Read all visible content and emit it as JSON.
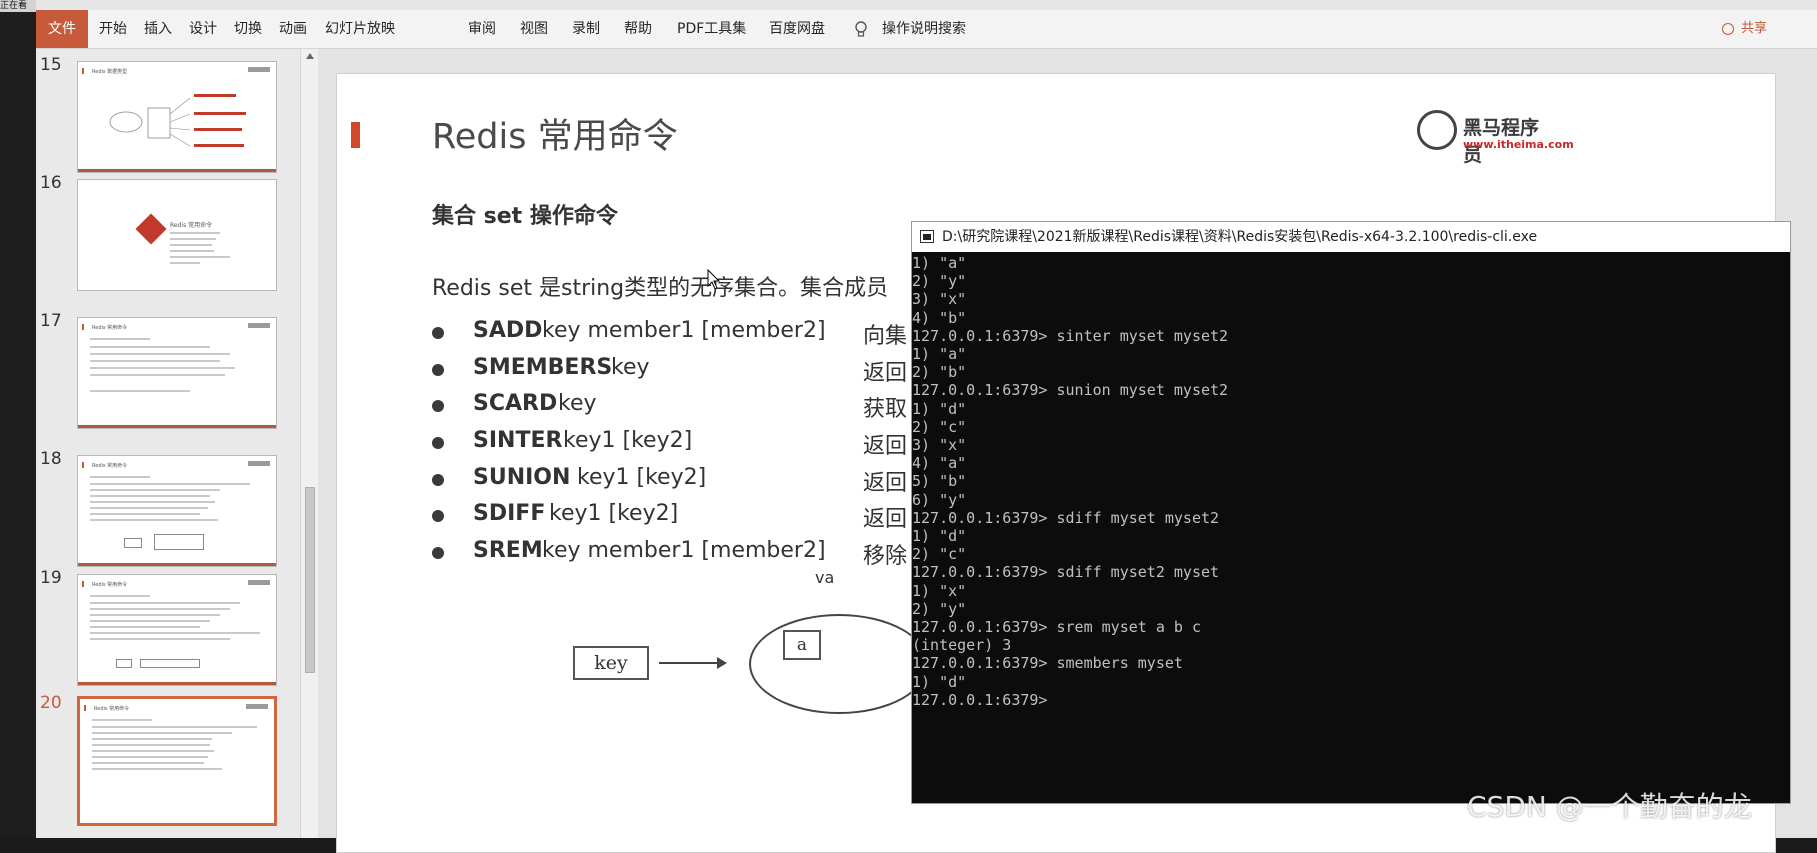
{
  "window": {
    "title_fragment": "正在看"
  },
  "ribbon": {
    "tabs": [
      "文件",
      "开始",
      "插入",
      "设计",
      "切换",
      "动画",
      "幻灯片放映",
      "审阅",
      "视图",
      "录制",
      "帮助",
      "PDF工具集",
      "百度网盘"
    ],
    "search_label": "操作说明搜索",
    "share_label": "共享"
  },
  "thumbnails": {
    "active_number": "20",
    "items": [
      {
        "number": "15",
        "title": "Redis 数据类型"
      },
      {
        "number": "16",
        "title": "Redis 常用命令"
      },
      {
        "number": "17",
        "title": "Redis 常用命令"
      },
      {
        "number": "18",
        "title": "Redis 常用命令"
      },
      {
        "number": "19",
        "title": "Redis 常用命令"
      },
      {
        "number": "20",
        "title": "Redis 常用命令"
      }
    ]
  },
  "slide": {
    "title": "Redis 常用命令",
    "section": "集合 set 操作命令",
    "intro": "Redis set 是string类型的无序集合。集合成员",
    "logo": {
      "name": "黑马程序员",
      "url": "www.itheima.com"
    },
    "commands": [
      {
        "name": "SADD",
        "args": "key member1 [member2]",
        "desc": "向集"
      },
      {
        "name": "SMEMBERS",
        "args": "key",
        "desc": "返回"
      },
      {
        "name": "SCARD",
        "args": "key",
        "desc": "获取"
      },
      {
        "name": "SINTER",
        "args": "key1 [key2]",
        "desc": "返回"
      },
      {
        "name": "SUNION",
        "args": "key1 [key2]",
        "desc": "返回"
      },
      {
        "name": "SDIFF",
        "args": "key1 [key2]",
        "desc": "返回"
      },
      {
        "name": "SREM",
        "args": "key member1 [member2]",
        "desc": "移除"
      }
    ],
    "diagram": {
      "key_label": "key",
      "member_label": "a",
      "value_fragment": "va"
    }
  },
  "console": {
    "title": "D:\\研究院课程\\2021新版课程\\Redis课程\\资料\\Redis安装包\\Redis-x64-3.2.100\\redis-cli.exe",
    "lines": [
      "1) \"a\"",
      "2) \"y\"",
      "3) \"x\"",
      "4) \"b\"",
      "127.0.0.1:6379> sinter myset myset2",
      "1) \"a\"",
      "2) \"b\"",
      "127.0.0.1:6379> sunion myset myset2",
      "1) \"d\"",
      "2) \"c\"",
      "3) \"x\"",
      "4) \"a\"",
      "5) \"b\"",
      "6) \"y\"",
      "127.0.0.1:6379> sdiff myset myset2",
      "1) \"d\"",
      "2) \"c\"",
      "127.0.0.1:6379> sdiff myset2 myset",
      "1) \"x\"",
      "2) \"y\"",
      "127.0.0.1:6379> srem myset a b c",
      "(integer) 3",
      "127.0.0.1:6379> smembers myset",
      "1) \"d\"",
      "127.0.0.1:6379>"
    ]
  },
  "watermark": "CSDN @一个勤奋的龙",
  "colors": {
    "accent": "#c85a3c",
    "console_bg": "#0c0c0c",
    "console_text": "#c0c0c0"
  }
}
